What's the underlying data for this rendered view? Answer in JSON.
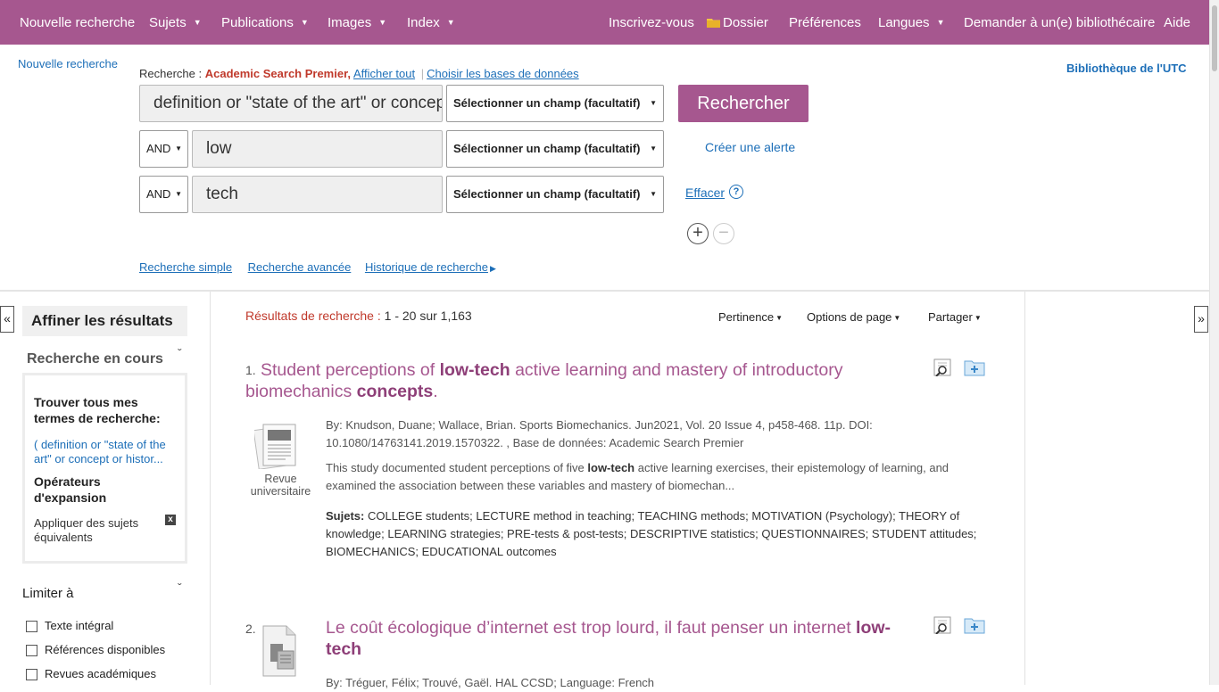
{
  "topnav": {
    "left": [
      "Nouvelle recherche",
      "Sujets",
      "Publications",
      "Images",
      "Index"
    ],
    "register": "Inscrivez-vous",
    "folder": "Dossier",
    "preferences": "Préférences",
    "languages": "Langues",
    "ask": "Demander à un(e) bibliothécaire",
    "help": "Aide"
  },
  "search": {
    "new_search": "Nouvelle recherche",
    "label": "Recherche :",
    "database": "Academic Search Premier,",
    "show_all": "Afficher tout",
    "choose_db": "Choisir les bases de données",
    "library": "Bibliothèque de l'UTC",
    "rows": [
      {
        "value": "definition or \"state of the art\" or concept",
        "field": "Sélectionner un champ (facultatif)"
      },
      {
        "bool": "AND",
        "value": "low",
        "field": "Sélectionner un champ (facultatif)"
      },
      {
        "bool": "AND",
        "value": "tech",
        "field": "Sélectionner un champ (facultatif)"
      }
    ],
    "button": "Rechercher",
    "alert": "Créer une alerte",
    "clear": "Effacer",
    "help_q": "?",
    "links": {
      "simple": "Recherche simple",
      "advanced": "Recherche avancée",
      "history": "Historique de recherche"
    }
  },
  "sidebar": {
    "collapse": "«",
    "title": "Affiner les résultats",
    "current": "Recherche en cours",
    "find_all": "Trouver tous mes termes de recherche:",
    "query": "( definition or \"state of the art\" or concept or histor...",
    "expanders": "Opérateurs d'expansion",
    "apply_subjects": "Appliquer des sujets équivalents",
    "remove": "x",
    "limit": "Limiter à",
    "limits": [
      "Texte intégral",
      "Références disponibles",
      "Revues académiques"
    ]
  },
  "results": {
    "label": "Résultats de recherche :",
    "range": "1 - 20 sur 1,163",
    "sort": "Pertinence",
    "page_options": "Options de page",
    "share": "Partager",
    "expand": "»",
    "items": [
      {
        "num": "1.",
        "title_parts": [
          "Student perceptions of ",
          "low-tech",
          " active learning and mastery of introductory biomechanics ",
          "concepts",
          "."
        ],
        "type": "Revue universitaire",
        "meta": "By: Knudson, Duane; Wallace, Brian. Sports Biomechanics. Jun2021, Vol. 20 Issue 4, p458-468. 11p. DOI: 10.1080/14763141.2019.1570322. , Base de données: Academic Search Premier",
        "abstract_parts": [
          "This study documented student perceptions of five ",
          "low-tech",
          " active learning exercises, their epistemology of learning, and examined the association between these variables and mastery of biomechan..."
        ],
        "subjects_label": "Sujets:",
        "subjects": "COLLEGE students; LECTURE method in teaching; TEACHING methods; MOTIVATION (Psychology); THEORY of knowledge; LEARNING strategies; PRE-tests & post-tests; DESCRIPTIVE statistics; QUESTIONNAIRES; STUDENT attitudes; BIOMECHANICS; EDUCATIONAL outcomes"
      },
      {
        "num": "2.",
        "title_parts": [
          "Le coût écologique d’internet est trop lourd, il faut penser un internet ",
          "low-tech"
        ],
        "meta": "By: Tréguer, Félix; Trouvé, Gaël. HAL CCSD; Language: French"
      }
    ]
  },
  "colors": {
    "brand": "#a6578f",
    "link": "#1d6fb8",
    "result_label": "#c0392b"
  }
}
